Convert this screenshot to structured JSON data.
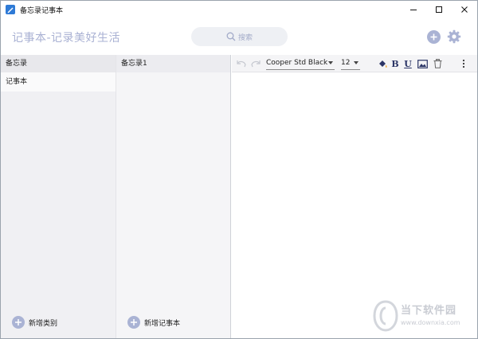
{
  "window": {
    "title": "备忘录记事本"
  },
  "header": {
    "slogan": "记事本-记录美好生活",
    "search_label": "搜索"
  },
  "categories": {
    "header": "备忘录",
    "items": [
      {
        "label": "记事本"
      }
    ],
    "add_label": "新增类别"
  },
  "notes": {
    "header": "备忘录1",
    "add_label": "新增记事本"
  },
  "toolbar": {
    "font_value": "Cooper Std Black",
    "size_value": "12",
    "bold_label": "B",
    "underline_label": "U"
  },
  "watermark": {
    "text": "当下软件园",
    "url": "www.downxia.com"
  },
  "colors": {
    "accent": "#aab3d4",
    "slogan": "#a9b1d3",
    "format_icons": "#2b3566"
  }
}
